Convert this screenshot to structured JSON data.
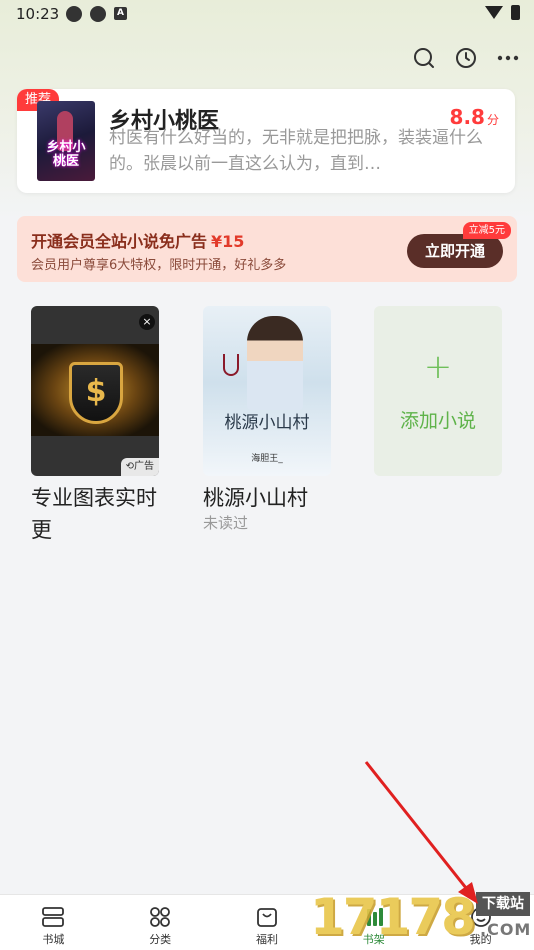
{
  "status_bar": {
    "time": "10:23"
  },
  "header": {
    "icons": [
      "search-icon",
      "history-icon",
      "more-icon"
    ]
  },
  "recommend": {
    "badge": "推荐",
    "title": "乡村小桃医",
    "score": "8.8",
    "score_unit": "分",
    "description": "村医有什么好当的，无非就是把把脉，装装逼什么的。张晨以前一直这么认为，直到…",
    "cover_title": "乡村小桃医"
  },
  "vip": {
    "title": "开通会员全站小说免广告",
    "price": "¥15",
    "subtitle": "会员用户尊享6大特权，限时开通，好礼多多",
    "button": "立即开通",
    "tag": "立减5元"
  },
  "shelf": {
    "ad": {
      "title": "专业图表实时更",
      "tag": "广告",
      "close": "×"
    },
    "book": {
      "title": "桃源小山村",
      "status": "未读过",
      "cover_title": "桃源小山村",
      "cover_author": "海胆王_"
    },
    "add": {
      "label": "添加小说",
      "plus": "+"
    }
  },
  "nav": {
    "items": [
      {
        "label": "书城",
        "icon": "bookstore-icon"
      },
      {
        "label": "分类",
        "icon": "category-icon"
      },
      {
        "label": "福利",
        "icon": "gift-icon"
      },
      {
        "label": "书架",
        "icon": "bookshelf-icon"
      },
      {
        "label": "我的",
        "icon": "profile-icon"
      }
    ]
  },
  "watermark": {
    "digits": "17178",
    "site": "下载站",
    "domain": ".COM"
  },
  "colors": {
    "accent_red": "#ff3b3b",
    "green": "#5fb34a",
    "vip_button": "#5a2e28"
  }
}
